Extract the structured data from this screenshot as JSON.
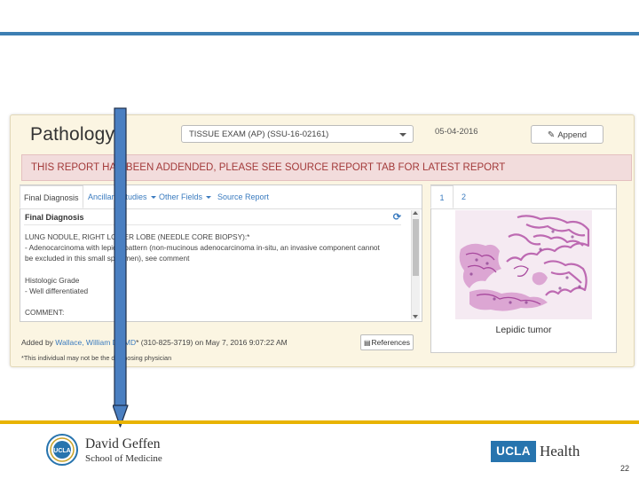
{
  "panel": {
    "title": "Pathology",
    "select_value": "TISSUE EXAM (AP) (SSU-16-02161)",
    "date": "05-04-2016",
    "append_label": "Append",
    "alert_text": "THIS REPORT HAS BEEN ADDENDED, PLEASE SEE SOURCE REPORT TAB FOR LATEST REPORT"
  },
  "report": {
    "tabs": [
      "Final Diagnosis",
      "Ancillary Studies",
      "Other Fields",
      "Source Report"
    ],
    "heading": "Final Diagnosis",
    "lines": [
      "LUNG NODULE, RIGHT LOWER LOBE (NEEDLE CORE BIOPSY):*",
      "- Adenocarcinoma with lepidic pattern (non-mucinous adenocarcinoma in-situ, an invasive component cannot",
      "be excluded in this small specimen), see comment",
      "",
      "Histologic Grade",
      "- Well differentiated",
      "",
      "COMMENT:"
    ],
    "added_prefix": "Added by",
    "added_name": "Wallace, William D., MD",
    "added_suffix": "* (310-825-3719) on May 7, 2016 9:07:22 AM",
    "references_label": "References",
    "note": "*This individual may not be the diagnosing physician"
  },
  "images": {
    "tabs": [
      "1",
      "2"
    ],
    "caption": "Lepidic tumor"
  },
  "footer": {
    "school_name": "David Geffen",
    "school_sub": "School of Medicine",
    "ucla_mark": "UCLA",
    "health_text": "Health",
    "seal_text": "UCLA",
    "page_number": "22"
  },
  "colors": {
    "top_rule": "#3d7fb3",
    "bottom_rule": "#e8b300",
    "alert_text": "#a33a3a",
    "link": "#3a7bbf",
    "ucla_blue": "#2774ae"
  },
  "icons": [
    "pencil-icon",
    "refresh-icon",
    "book-icon",
    "caret-down-icon",
    "arrow-down-icon"
  ]
}
